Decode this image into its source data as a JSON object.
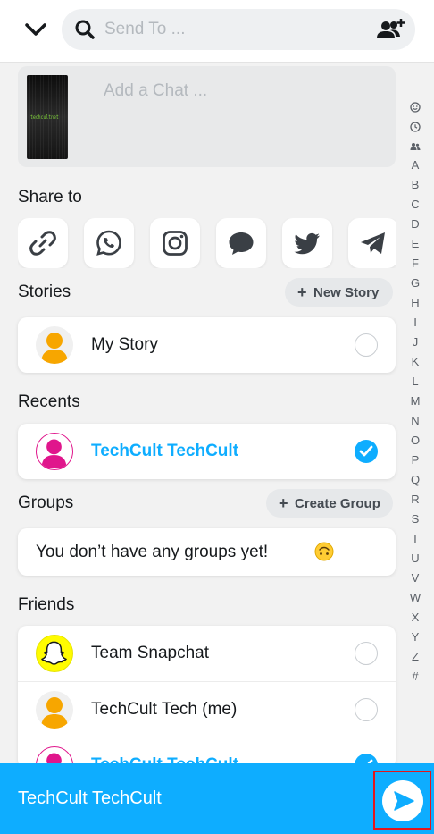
{
  "header": {
    "search_placeholder": "Send To ...",
    "icons": [
      "chevron-down-icon",
      "search-icon",
      "add-friend-icon"
    ]
  },
  "chat_box": {
    "placeholder": "Add a Chat ...",
    "thumbnail_text": "techcultnet"
  },
  "share": {
    "title": "Share to",
    "targets": [
      "link-icon",
      "whatsapp-icon",
      "instagram-icon",
      "messages-icon",
      "twitter-icon",
      "telegram-icon"
    ]
  },
  "stories": {
    "title": "Stories",
    "action_label": "New Story",
    "items": [
      {
        "name": "My Story",
        "selected": false,
        "avatar_color": "#f7a600"
      }
    ]
  },
  "recents": {
    "title": "Recents",
    "items": [
      {
        "name": "TechCult TechCult",
        "selected": true,
        "avatar_color": "#e0168c"
      }
    ]
  },
  "groups": {
    "title": "Groups",
    "action_label": "Create Group",
    "empty_text": "You don’t have any groups yet!"
  },
  "friends": {
    "title": "Friends",
    "items": [
      {
        "name": "Team Snapchat",
        "selected": false,
        "avatar": "snapchat-ghost-icon"
      },
      {
        "name": "TechCult Tech (me)",
        "selected": false,
        "avatar_color": "#f7a600"
      },
      {
        "name": "TechCult TechCult",
        "selected": true,
        "avatar_color": "#e0168c"
      }
    ]
  },
  "alphabet_index": [
    "smiley-icon",
    "clock-icon",
    "group-icon",
    "A",
    "B",
    "C",
    "D",
    "E",
    "F",
    "G",
    "H",
    "I",
    "J",
    "K",
    "L",
    "M",
    "N",
    "O",
    "P",
    "Q",
    "R",
    "S",
    "T",
    "U",
    "V",
    "W",
    "X",
    "Y",
    "Z",
    "#"
  ],
  "bottom_bar": {
    "selected_name": "TechCult TechCult",
    "send_icon": "send-arrow-icon"
  },
  "colors": {
    "accent": "#0eadff",
    "highlight_border": "#e3161b",
    "snapchat_yellow": "#fffc00"
  }
}
